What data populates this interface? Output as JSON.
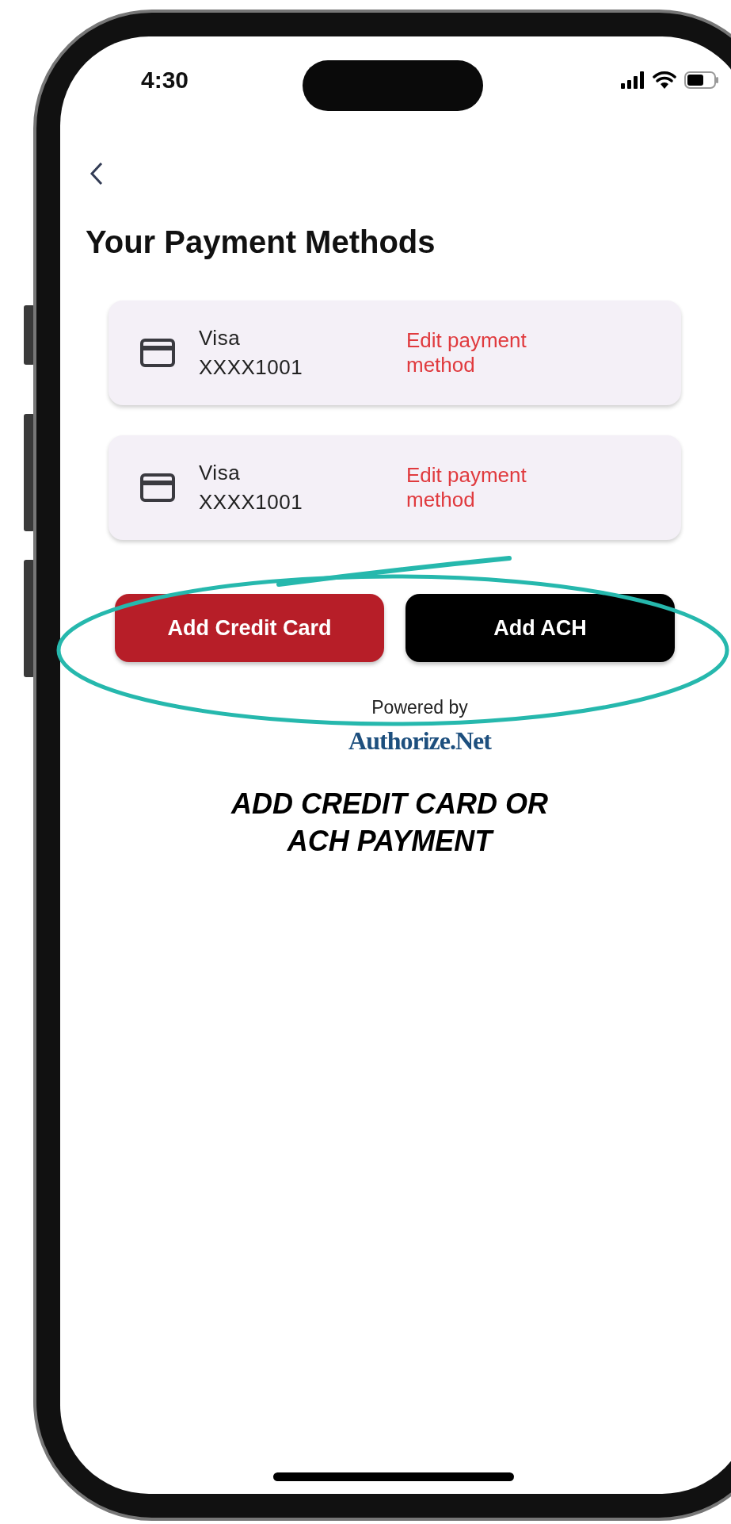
{
  "status_bar": {
    "time": "4:30"
  },
  "title": "Your Payment Methods",
  "payment_methods": [
    {
      "brand": "Visa",
      "number": "XXXX1001",
      "action": "Edit payment method"
    },
    {
      "brand": "Visa",
      "number": "XXXX1001",
      "action": "Edit payment method"
    }
  ],
  "buttons": [
    {
      "label": "Add Credit Card",
      "kind": "primary"
    },
    {
      "label": "Add ACH",
      "kind": "secondary"
    }
  ],
  "powered_by": {
    "label": "Powered by",
    "provider": "Authorize.Net"
  },
  "annotation": {
    "text": "ADD CREDIT CARD OR ACH PAYMENT"
  }
}
